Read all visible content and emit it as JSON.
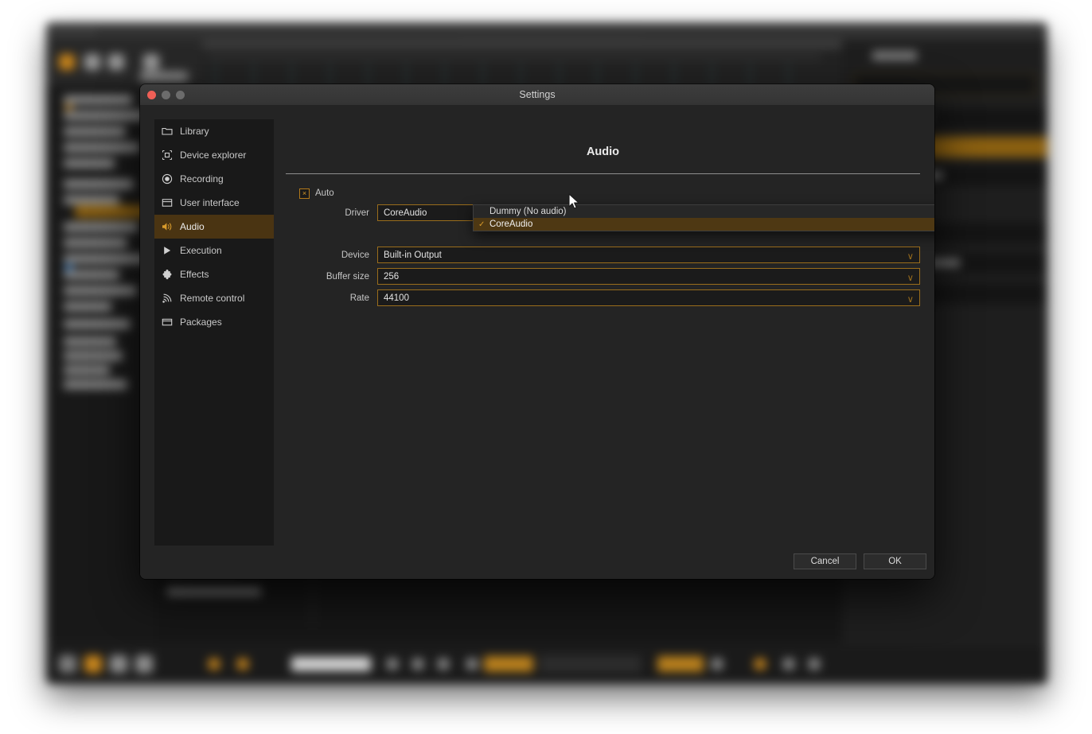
{
  "background_app": {
    "description": "blurred dark audio/DAW application window behind modal"
  },
  "modal": {
    "title": "Settings",
    "traffic_lights": [
      "close",
      "minimize",
      "maximize"
    ],
    "sidebar": {
      "items": [
        {
          "label": "Library",
          "icon": "folder-icon",
          "active": false
        },
        {
          "label": "Device explorer",
          "icon": "crosshair-icon",
          "active": false
        },
        {
          "label": "Recording",
          "icon": "record-icon",
          "active": false
        },
        {
          "label": "User interface",
          "icon": "window-icon",
          "active": false
        },
        {
          "label": "Audio",
          "icon": "speaker-icon",
          "active": true
        },
        {
          "label": "Execution",
          "icon": "play-icon",
          "active": false
        },
        {
          "label": "Effects",
          "icon": "puzzle-icon",
          "active": false
        },
        {
          "label": "Remote control",
          "icon": "broadcast-icon",
          "active": false
        },
        {
          "label": "Packages",
          "icon": "package-icon",
          "active": false
        }
      ]
    },
    "content": {
      "heading": "Audio",
      "auto_checkbox": {
        "label": "Auto",
        "checked": true,
        "check_glyph": "×"
      },
      "fields": [
        {
          "label": "Driver",
          "value": "CoreAudio",
          "chevron": "∨"
        },
        {
          "label": "Device",
          "value": "Built-in Output",
          "chevron": "∨"
        },
        {
          "label": "Buffer size",
          "value": "256",
          "chevron": "∨"
        },
        {
          "label": "Rate",
          "value": "44100",
          "chevron": "∨"
        }
      ],
      "dropdown": {
        "open": true,
        "for_field": "Driver",
        "options": [
          {
            "label": "Dummy (No audio)",
            "selected": false,
            "check": ""
          },
          {
            "label": "CoreAudio",
            "selected": true,
            "check": "✓"
          }
        ]
      }
    },
    "footer": {
      "cancel_label": "Cancel",
      "ok_label": "OK"
    }
  },
  "colors": {
    "accent_amber": "#b9801c",
    "accent_highlight": "#4a3412",
    "modal_bg": "#242424",
    "sidebar_bg": "#191919",
    "field_border": "#9a6d1c",
    "close_red": "#ef5f56"
  }
}
